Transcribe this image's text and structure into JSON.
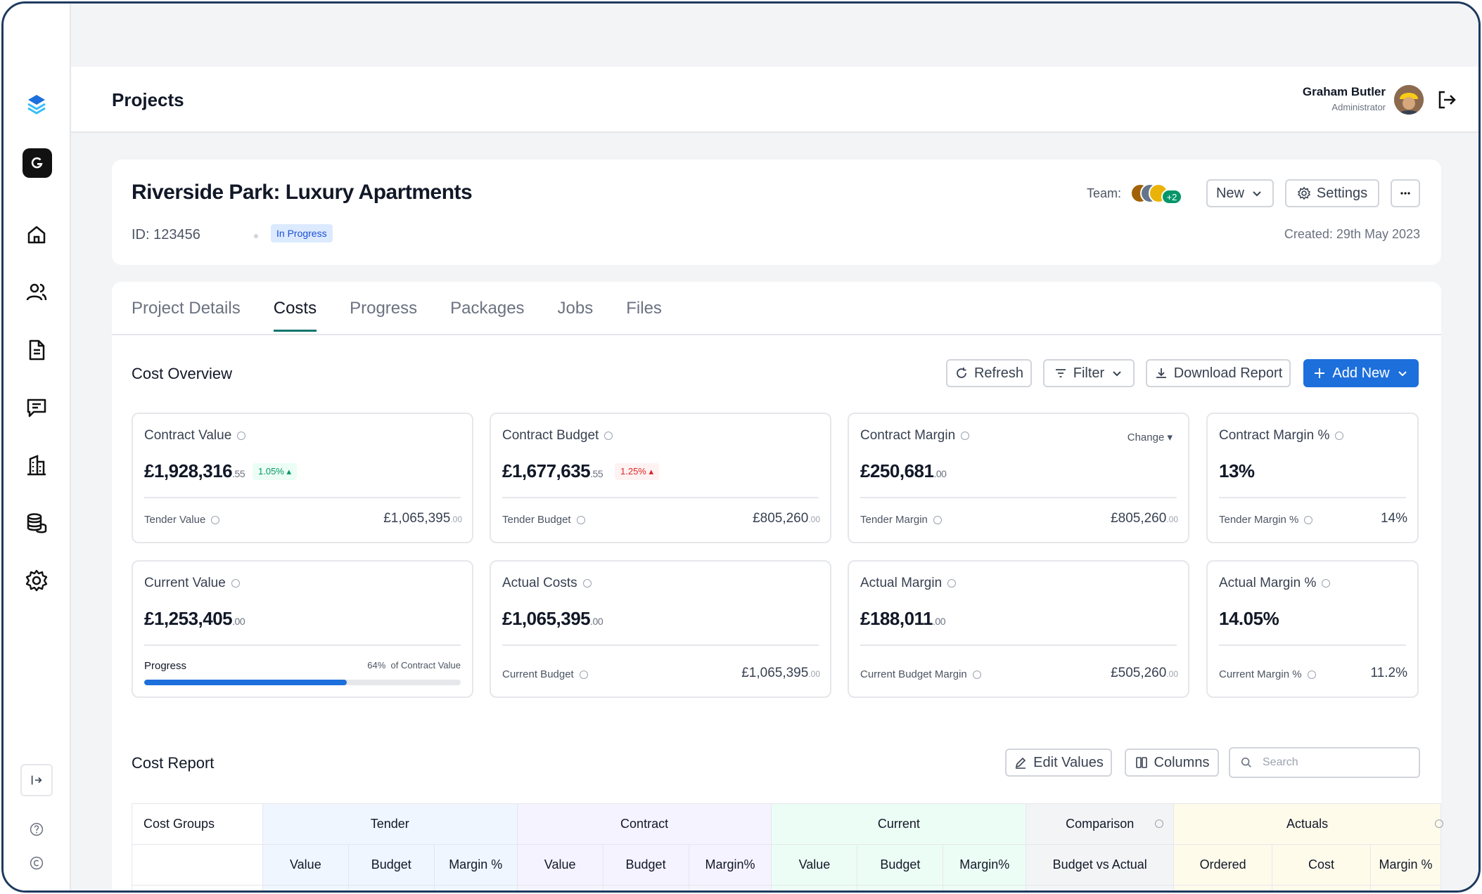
{
  "page": {
    "title": "Projects"
  },
  "user": {
    "name": "Graham Butler",
    "role": "Administrator"
  },
  "project": {
    "title": "Riverside Park: Luxury Apartments",
    "id": "ID: 123456",
    "status": "In Progress",
    "team_label": "Team:",
    "team_extra": "+2",
    "created": "Created:  29th May 2023",
    "new_label": "New",
    "settings_label": "Settings"
  },
  "tabs": [
    "Project Details",
    "Costs",
    "Progress",
    "Packages",
    "Jobs",
    "Files"
  ],
  "overview": {
    "title": "Cost Overview",
    "refresh": "Refresh",
    "filter": "Filter",
    "download": "Download Report",
    "add_new": "Add New"
  },
  "metrics": {
    "contract_value": {
      "label": "Contract Value",
      "main": "£1,928,316",
      "pence": ".55",
      "badge": "1.05% ▴",
      "sub_label": "Tender Value",
      "sub_main": "£1,065,395",
      "sub_pence": ".00"
    },
    "contract_budget": {
      "label": "Contract Budget",
      "main": "£1,677,635",
      "pence": ".55",
      "badge": "1.25% ▴",
      "sub_label": "Tender Budget",
      "sub_main": "£805,260",
      "sub_pence": ".00"
    },
    "contract_margin": {
      "label": "Contract Margin",
      "main": "£250,681",
      "pence": ".00",
      "change": "Change ▾",
      "sub_label": "Tender Margin",
      "sub_main": "£805,260",
      "sub_pence": ".00"
    },
    "contract_margin_pct": {
      "label": "Contract Margin %",
      "main": "13%",
      "sub_label": "Tender Margin %",
      "sub_main": "14%"
    },
    "current_value": {
      "label": "Current Value",
      "main": "£1,253,405",
      "pence": ".00",
      "progress_label": "Progress",
      "progress_pct": "64%",
      "progress_note_suffix": "of Contract Value",
      "progress_fraction": 0.64
    },
    "actual_costs": {
      "label": "Actual Costs",
      "main": "£1,065,395",
      "pence": ".00",
      "sub_label": "Current Budget",
      "sub_main": "£1,065,395",
      "sub_pence": ".00"
    },
    "actual_margin": {
      "label": "Actual Margin",
      "main": "£188,011",
      "pence": ".00",
      "sub_label": "Current Budget Margin",
      "sub_main": "£505,260",
      "sub_pence": ".00"
    },
    "actual_margin_pct": {
      "label": "Actual Margin %",
      "main": "14.05%",
      "sub_label": "Current Margin %",
      "sub_main": "11.2%"
    }
  },
  "report": {
    "title": "Cost Report",
    "edit_values": "Edit Values",
    "columns": "Columns",
    "search_placeholder": "Search",
    "group_header": "Cost Groups",
    "groups": [
      "Tender",
      "Contract",
      "Current",
      "Comparison",
      "Actuals"
    ],
    "subheaders": [
      "Value",
      "Budget",
      "Margin %",
      "Value",
      "Budget",
      "Margin%",
      "Value",
      "Budget",
      "Margin%",
      "Budget vs Actual",
      "Ordered",
      "Cost",
      "Margin %"
    ]
  },
  "colors": {
    "accent": "#1d6fdc",
    "tab_underline": "#0f766e",
    "tender_bg": "#eff6ff",
    "contract_bg": "#f5f3ff",
    "current_bg": "#ecfdf5",
    "comparison_bg": "#f3f4f6",
    "actuals_bg": "#fffbeb"
  }
}
